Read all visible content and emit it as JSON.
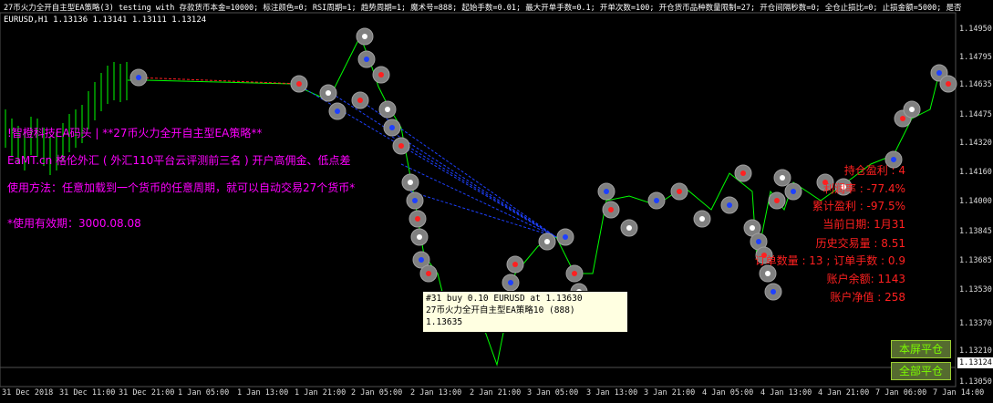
{
  "header": {
    "settings_line": "27币火力全开自主型EA策略(3) testing with 存款货币本金=10000; 标注颜色=0; RSI周期=1; 趋势周期=1; 魔术号=888; 起始手数=0.01; 最大开单手数=0.1; 开单次数=100; 开仓货币品种数量限制=27; 开仓间隔秒数=0; 全仓止损比=0; 止损金额=5000; 是否",
    "symbol_line": "EURUSD,H1  1.13136 1.13141 1.13111 1.13124"
  },
  "promo": {
    "line1": "!智橙科技EA码头 | **27币火力全开自主型EA策略**",
    "line2": "EaMT.cn 格伦外汇 ( 外汇110平台云评测前三名 ) 开户高佣金、低点差",
    "line3": "使用方法：任意加载到一个货币的任意周期，就可以自动交易27个货币*",
    "line4": "*使用有效期：3000.08.08"
  },
  "stats": [
    {
      "label": "持仓盈利 : 4"
    },
    {
      "label": "利润率 : -77.4%"
    },
    {
      "label": "累计盈利 : -97.5%"
    },
    {
      "label": "当前日期: 1月31"
    },
    {
      "label": "历史交易量 : 8.51"
    },
    {
      "label": "订单数量 : 13 ; 订单手数 : 0.9"
    },
    {
      "label": "账户余额: 1143"
    },
    {
      "label": "账户净值 : 258"
    }
  ],
  "price_axis": [
    "1.14950",
    "1.14795",
    "1.14635",
    "1.14475",
    "1.14320",
    "1.14160",
    "1.14000",
    "1.13845",
    "1.13685",
    "1.13530",
    "1.13370",
    "1.13210",
    "1.13050"
  ],
  "current_price": "1.13124",
  "time_axis": [
    "31 Dec 2018",
    "31 Dec 11:00",
    "31 Dec 21:00",
    "1 Jan 05:00",
    "1 Jan 13:00",
    "1 Jan 21:00",
    "2 Jan 05:00",
    "2 Jan 13:00",
    "2 Jan 21:00",
    "3 Jan 05:00",
    "3 Jan 13:00",
    "3 Jan 21:00",
    "4 Jan 05:00",
    "4 Jan 13:00",
    "4 Jan 21:00",
    "7 Jan 06:00",
    "7 Jan 14:00"
  ],
  "buttons": {
    "close_half": "本屏平仓",
    "close_all": "全部平仓"
  },
  "tooltip": {
    "line1": "#31 buy 0.10 EURUSD at 1.13630",
    "line2": "27币火力全开自主型EA策略10 (888)",
    "line3": "1.13635"
  },
  "colors": {
    "background": "#000000",
    "bullish": "#00ff00",
    "grid": "#1a1a1a",
    "promo": "#ff00ff",
    "stats": "#ff2020",
    "marker_ring": "#808080",
    "buy_arrow": "#1e40ff",
    "sell_arrow": "#ff2020"
  }
}
